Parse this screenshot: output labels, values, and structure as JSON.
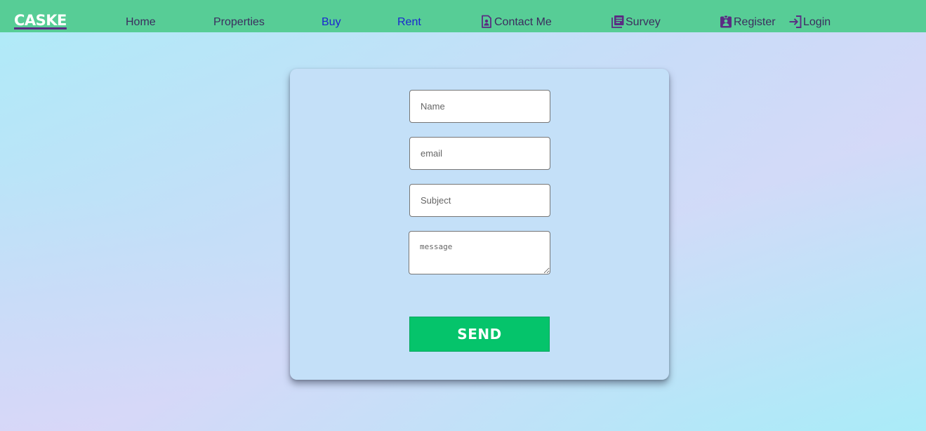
{
  "brand": {
    "name": "CASKE"
  },
  "nav": {
    "home": "Home",
    "properties": "Properties",
    "buy": "Buy",
    "rent": "Rent",
    "contact": "Contact Me",
    "survey": "Survey",
    "register": "Register",
    "login": "Login"
  },
  "form": {
    "name_placeholder": "Name",
    "email_placeholder": "email",
    "subject_placeholder": "Subject",
    "message_placeholder": "message",
    "send_label": "SEND"
  },
  "icons": {
    "contact": "contact-card-icon",
    "survey": "survey-list-icon",
    "register": "register-badge-icon",
    "login": "login-arrow-icon"
  },
  "colors": {
    "navbar": "#57cd96",
    "accent_purple": "#5b2c83",
    "link_blue": "#1a26d0",
    "send_button": "#05c46b",
    "card": "#c4e0f8"
  }
}
